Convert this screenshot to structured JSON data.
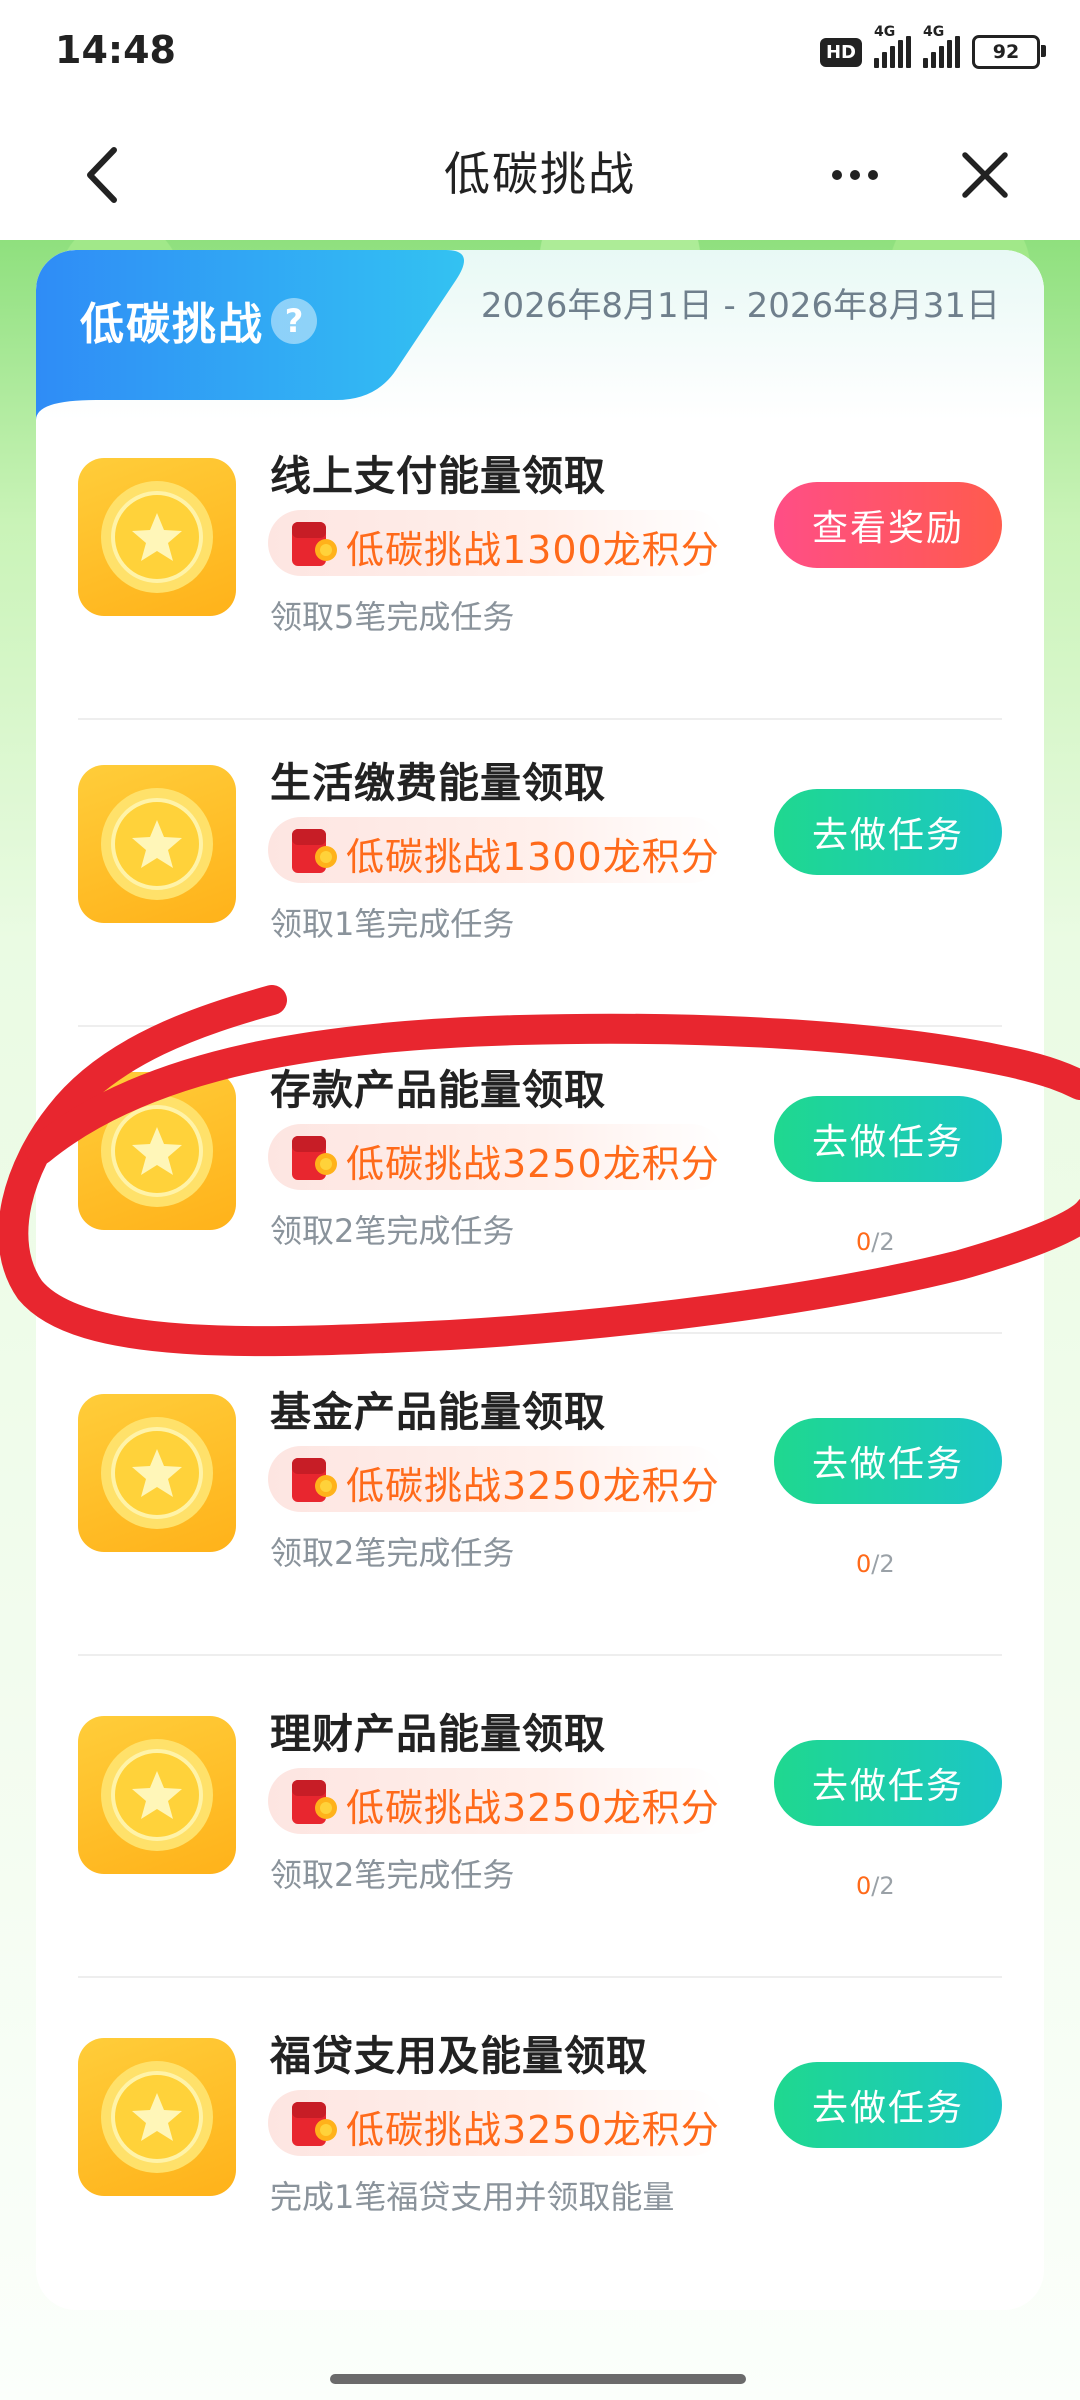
{
  "status_bar": {
    "time": "14:48",
    "hd": "HD",
    "network_1": "4G",
    "network_2": "4G",
    "battery": "92"
  },
  "nav": {
    "title": "低碳挑战",
    "back_icon": "chevron-left-icon",
    "more_icon": "more-horizontal-icon",
    "close_icon": "close-icon"
  },
  "header": {
    "tab_label": "低碳挑战",
    "help": "?",
    "date_range": "2026年8月1日 - 2026年8月31日"
  },
  "tasks": [
    {
      "title": "线上支付能量领取",
      "reward": "低碳挑战1300龙积分",
      "desc": "领取5笔完成任务",
      "button": "查看奖励",
      "progress_done": "",
      "progress_total": ""
    },
    {
      "title": "生活缴费能量领取",
      "reward": "低碳挑战1300龙积分",
      "desc": "领取1笔完成任务",
      "button": "去做任务",
      "progress_done": "",
      "progress_total": ""
    },
    {
      "title": "存款产品能量领取",
      "reward": "低碳挑战3250龙积分",
      "desc": "领取2笔完成任务",
      "button": "去做任务",
      "progress_done": "0",
      "progress_total": "/2"
    },
    {
      "title": "基金产品能量领取",
      "reward": "低碳挑战3250龙积分",
      "desc": "领取2笔完成任务",
      "button": "去做任务",
      "progress_done": "0",
      "progress_total": "/2"
    },
    {
      "title": "理财产品能量领取",
      "reward": "低碳挑战3250龙积分",
      "desc": "领取2笔完成任务",
      "button": "去做任务",
      "progress_done": "0",
      "progress_total": "/2"
    },
    {
      "title": "福贷支用及能量领取",
      "reward": "低碳挑战3250龙积分",
      "desc": "完成1笔福贷支用并领取能量",
      "button": "去做任务",
      "progress_done": "",
      "progress_total": ""
    }
  ],
  "colors": {
    "primary_blue": "#2f8cf6",
    "pink_button": "#ff4e86",
    "green_button": "#1fd88f",
    "reward_orange": "#ff6a1a",
    "annotation_red": "#e8262f"
  }
}
